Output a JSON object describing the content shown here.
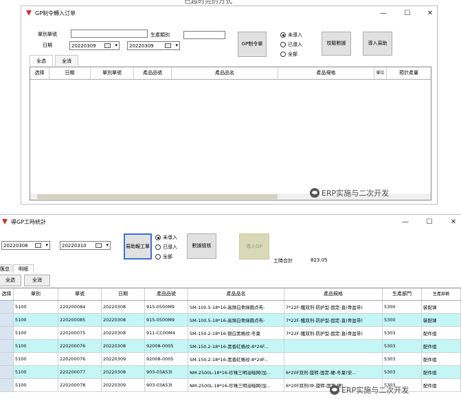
{
  "top_caption": "已超时完的方式",
  "window1": {
    "title": "GP制令轉入订单",
    "controls": {
      "minimize": "—",
      "maximize": "☐",
      "close": "✕"
    },
    "fields": {
      "order_no_label": "單別單號",
      "order_no_value": "",
      "production_type_label": "生產類別",
      "production_type_value": "",
      "date_label": "日期",
      "date_from": "20220309",
      "date_to": "20220309"
    },
    "buttons": {
      "gp_order": "GP制令單",
      "check_data": "校驗數據",
      "import_erp": "導入易助"
    },
    "radios": [
      {
        "label": "未導入",
        "checked": true
      },
      {
        "label": "已導入",
        "checked": false
      },
      {
        "label": "全部",
        "checked": false
      }
    ],
    "tabs": [
      "全选",
      "全消"
    ],
    "table_headers": [
      "选择",
      "日期",
      "單別單號",
      "產品品號",
      "產品品名",
      "產品規格",
      "單位",
      "預計產量"
    ]
  },
  "window2": {
    "title": "導GP工時統計",
    "controls": {
      "minimize": "—",
      "maximize": "☐",
      "close": "✕"
    },
    "date_from": "20220308",
    "date_to": "20220310",
    "buttons": {
      "import_work": "易助報工單",
      "check_data": "數據檢核",
      "import_gp": "導入GP"
    },
    "radios": [
      {
        "label": "未導入",
        "checked": true
      },
      {
        "label": "已導入",
        "checked": false
      },
      {
        "label": "全部",
        "checked": false
      }
    ],
    "work_total_label": "工時合計",
    "work_total_value": "823.05",
    "tabs": [
      "匯总",
      "明细"
    ],
    "select_buttons": [
      "全选",
      "全消"
    ],
    "table_headers": [
      "选择",
      "單别",
      "單號",
      "日期",
      "產品品號",
      "產品品名",
      "產品規格",
      "生產部門",
      "生產部稱"
    ],
    "rows": [
      {
        "type": "5100",
        "no": "220200084",
        "date": "20220308",
        "item": "915-0500M9",
        "name": "SM-100.5-18*16-高頻白骨綠圓点布-",
        "spec": "7*22F-鐵双剂-防护型-固定-直(骨盆带)",
        "dept": "5300",
        "dept_name": "裝配课",
        "color": "white"
      },
      {
        "type": "5100",
        "no": "220200085",
        "date": "20220308",
        "item": "915-0500M9",
        "name": "SM-100.5-18*16-高頻白骨綠圓点布-",
        "spec": "7*22F-鐵双剂-防护型-固定-直(骨盆带)",
        "dept": "5300",
        "dept_name": "裝配课",
        "color": "cyan"
      },
      {
        "type": "5100",
        "no": "220200075",
        "date": "20220308",
        "item": "911-CC00M4",
        "name": "SM-150.2-18*16-银白黑格纹-冬夏",
        "spec": "7*22F-鐵双剂-防护型-固定-直(骨盆带)",
        "dept": "5303",
        "dept_name": "配件组",
        "color": "white"
      },
      {
        "type": "5100",
        "no": "220200076",
        "date": "20220308",
        "item": "92008-0005",
        "name": "SM-150.2-18*16-黑香缸格纹-8*24F...",
        "spec": "",
        "dept": "5303",
        "dept_name": "配件组",
        "color": "cyan"
      },
      {
        "type": "5100",
        "no": "220200076",
        "date": "20220309",
        "item": "92008-0005",
        "name": "SM-150.2-18*16-黑香缸格纹-8*24F...",
        "spec": "",
        "dept": "5303",
        "dept_name": "配件组",
        "color": "white"
      },
      {
        "type": "5100",
        "no": "220200077",
        "date": "20220308",
        "item": "903-03A53I",
        "name": "NM-2500L-18*16-珍珠三明治暗网(加...",
        "spec": "6*20F双剂-旋转-固定-硬-冬夏(安...",
        "dept": "5303",
        "dept_name": "配件组",
        "color": "cyan"
      },
      {
        "type": "5100",
        "no": "220200078",
        "date": "20220309",
        "item": "903-03A53I",
        "name": "NM-2500L-18*16-珍珠三明治暗网(加...",
        "spec": "6*20F双剂(中-旋转-固定-硬)...",
        "dept": "5303",
        "dept_name": "配件组",
        "color": "white"
      }
    ]
  },
  "watermark_top": "ERP实施与二次开发",
  "watermark_bottom": "ERP实施与二次开发",
  "colors": {
    "cyan_row": "#c4f6f6",
    "focus_border": "#3c6fd1",
    "disabled_btn": "#d9d9b8"
  }
}
